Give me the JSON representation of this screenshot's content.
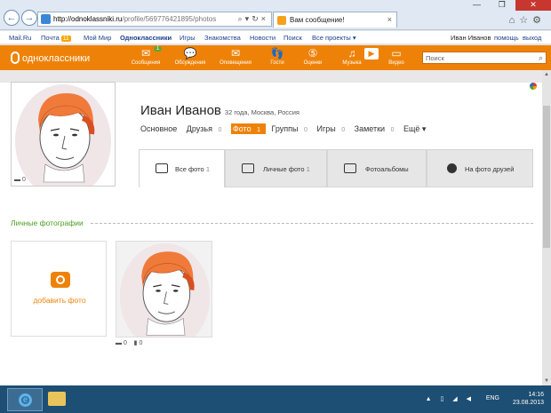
{
  "browser": {
    "url_domain": "http://odnoklassniki.ru",
    "url_rest": "/profile/569776421895/photos",
    "tab_title": "Вам сообщение!",
    "tab_close": "×"
  },
  "mailbar": {
    "left": [
      "Mail.Ru",
      "Почта",
      "Мой Мир",
      "Одноклассники",
      "Игры",
      "Знакомства",
      "Новости",
      "Поиск",
      "Все проекты ▾"
    ],
    "mail_count": "11",
    "user": "Иван Иванов",
    "help": "помощь",
    "exit": "выход"
  },
  "ok": {
    "logo": "одноклассники",
    "items": [
      "Сообщения",
      "Обсуждения",
      "Оповещения",
      "Гости",
      "Оценки",
      "Музыка",
      "Видео"
    ],
    "messages_badge": "1",
    "search_placeholder": "Поиск"
  },
  "profile": {
    "name": "Иван Иванов",
    "meta": "32 года, Москва, Россия",
    "avatar_comments": "0",
    "tabs": [
      {
        "label": "Основное",
        "count": ""
      },
      {
        "label": "Друзья",
        "count": "0"
      },
      {
        "label": "Фото",
        "count": "1"
      },
      {
        "label": "Группы",
        "count": "0"
      },
      {
        "label": "Игры",
        "count": "0"
      },
      {
        "label": "Заметки",
        "count": "0"
      },
      {
        "label": "Ещё ▾",
        "count": ""
      }
    ]
  },
  "photo_tabs": [
    {
      "label": "Все фото",
      "count": "1"
    },
    {
      "label": "Личные фото",
      "count": "1"
    },
    {
      "label": "Фотоальбомы",
      "count": ""
    },
    {
      "label": "На фото друзей",
      "count": ""
    }
  ],
  "section": {
    "title": "Личные фотографии",
    "add_label": "добавить фото",
    "photo_comments": "0",
    "photo_views": "0"
  },
  "taskbar": {
    "lang": "ENG",
    "time": "14:16",
    "date": "23.08.2013"
  },
  "colors": {
    "accent": "#ee8208",
    "section_green": "#4c9f1c"
  }
}
